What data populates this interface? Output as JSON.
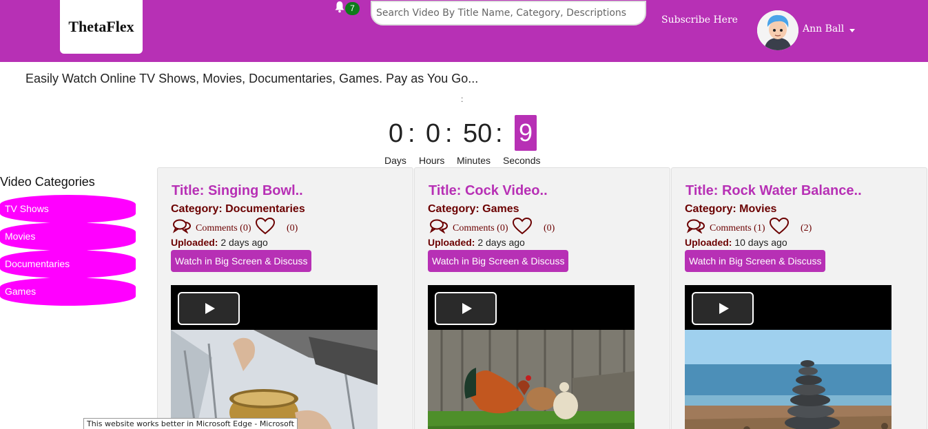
{
  "header": {
    "logo": "ThetaFlex",
    "notification_count": "7",
    "search_placeholder": "Search Video By Title Name, Category, Descriptions",
    "subscribe_label": "Subscribe Here",
    "user_name": "Ann Ball",
    "accent_color": "#b730b5"
  },
  "tagline": "Easily Watch Online TV Shows, Movies, Documentaries, Games. Pay as You Go...",
  "countdown": {
    "separator": ":",
    "days": "0",
    "hours": "0",
    "minutes": "50",
    "seconds": "9",
    "labels": {
      "days": "Days",
      "hours": "Hours",
      "minutes": "Minutes",
      "seconds": "Seconds"
    }
  },
  "sidebar": {
    "title": "Video Categories",
    "items": [
      "TV Shows",
      "Movies",
      "Documentaries",
      "Games"
    ]
  },
  "videos": [
    {
      "title": "Title: Singing Bowl..",
      "category": "Category: Documentaries",
      "comments": "Comments (0)",
      "likes": "(0)",
      "uploaded_label": "Uploaded:",
      "uploaded_value": " 2 days ago",
      "watch_label": "Watch in Big Screen & Discuss"
    },
    {
      "title": "Title: Cock Video..",
      "category": "Category: Games",
      "comments": "Comments (0)",
      "likes": "(0)",
      "uploaded_label": "Uploaded:",
      "uploaded_value": " 2 days ago",
      "watch_label": "Watch in Big Screen & Discuss"
    },
    {
      "title": "Title: Rock Water Balance..",
      "category": "Category: Movies",
      "comments": "Comments (1)",
      "likes": "(2)",
      "uploaded_label": "Uploaded:",
      "uploaded_value": " 10 days ago",
      "watch_label": "Watch in Big Screen & Discuss"
    }
  ],
  "browser_tooltip": "This website works better in Microsoft Edge - Microsoft"
}
